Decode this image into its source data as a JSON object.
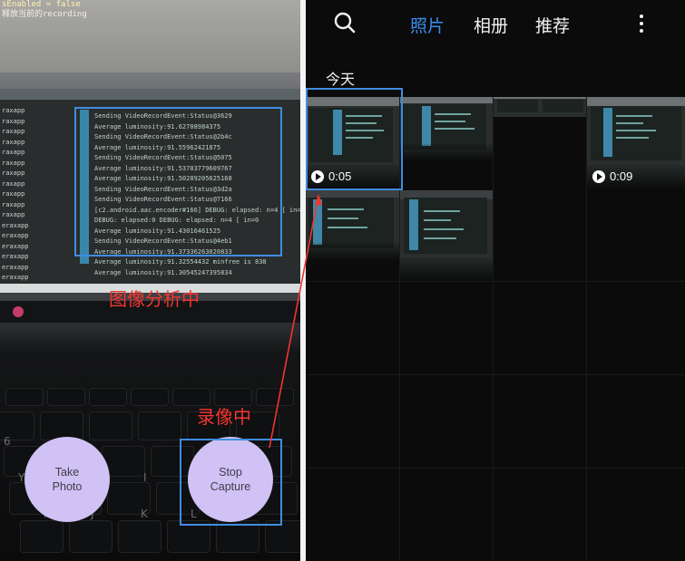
{
  "camera": {
    "header_lines": [
      "sEnabled = false",
      "释放当前的recording"
    ],
    "log_lines": [
      "Sending VideoRecordEvent:Status@3629",
      "Average luminosity:91.62708984375",
      "Sending VideoRecordEvent:Status@2b4c",
      "Average luminosity:91.55962421875",
      "Sending VideoRecordEvent:Status@5075",
      "Average luminosity:91.53703779609767",
      "Average luminosity:91.50289205625168",
      "Sending VideoRecordEvent:Status@3d2a",
      "Sending VideoRecordEvent:Status@7166",
      "[c2.android.aac.encoder#166] DEBUG: elapsed: n=4 [ in=0 ]",
      "DEBUG: elapsed:0  DEBUG: elapsed: n=4 [ in=0",
      "Average luminosity:91.43016461525",
      "Sending VideoRecordEvent:Status@4eb1",
      "Average luminosity:91.37336263020833",
      "Average luminosity:91.32554432  minfree is 838",
      "Average luminosity:91.30545247395834"
    ],
    "side_list": [
      "raxapp",
      "raxapp",
      "raxapp",
      "raxapp",
      "raxapp",
      "raxapp",
      "raxapp",
      "raxapp",
      "raxapp",
      "raxapp",
      "raxapp",
      "eraxapp",
      "eraxapp",
      "eraxapp",
      "eraxapp",
      "eraxapp",
      "eraxapp"
    ],
    "annotation_analysis": "图像分析中",
    "annotation_recording": "录像中",
    "take_photo": "Take\nPhoto",
    "stop_capture": "Stop\nCapture",
    "key_chars": [
      "6",
      "Y",
      "U",
      "I",
      "O",
      "P",
      "H",
      "J",
      "K",
      "L"
    ]
  },
  "gallery": {
    "tabs": [
      {
        "label": "照片",
        "active": true
      },
      {
        "label": "相册",
        "active": false
      },
      {
        "label": "推荐",
        "active": false
      }
    ],
    "section_label": "今天",
    "videos": [
      {
        "duration": "0:05"
      },
      {
        "duration": "0:09"
      }
    ]
  },
  "colors": {
    "accent_blue": "#3a8df0",
    "annotation_red": "#f2352f",
    "button_purple": "#d0c2f4"
  },
  "icons": [
    "search-icon",
    "more-vertical-icon",
    "play-icon"
  ]
}
